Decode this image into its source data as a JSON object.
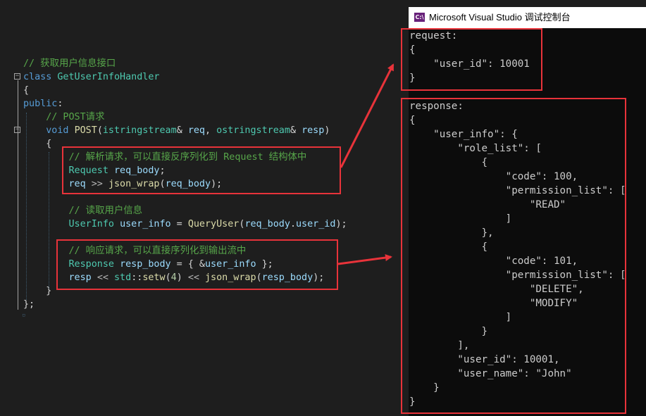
{
  "editor": {
    "lines": [
      {
        "tokens": [
          [
            "cm",
            "// 获取用户信息接口"
          ]
        ]
      },
      {
        "tokens": [
          [
            "kw",
            "class"
          ],
          [
            "pl",
            " "
          ],
          [
            "ty",
            "GetUserInfoHandler"
          ]
        ]
      },
      {
        "tokens": [
          [
            "pl",
            "{"
          ]
        ]
      },
      {
        "tokens": [
          [
            "kw",
            "public"
          ],
          [
            "pl",
            ":"
          ]
        ]
      },
      {
        "tokens": [
          [
            "pl",
            "    "
          ],
          [
            "cm",
            "// POST请求"
          ]
        ]
      },
      {
        "tokens": [
          [
            "pl",
            "    "
          ],
          [
            "kw",
            "void"
          ],
          [
            "pl",
            " "
          ],
          [
            "fn",
            "POST"
          ],
          [
            "pl",
            "("
          ],
          [
            "ty",
            "istringstream"
          ],
          [
            "pl",
            "& "
          ],
          [
            "vr",
            "req"
          ],
          [
            "pl",
            ", "
          ],
          [
            "ty",
            "ostringstream"
          ],
          [
            "pl",
            "& "
          ],
          [
            "vr",
            "resp"
          ],
          [
            "pl",
            ")"
          ]
        ]
      },
      {
        "tokens": [
          [
            "pl",
            "    {"
          ]
        ]
      },
      {
        "tokens": [
          [
            "pl",
            "        "
          ],
          [
            "cm",
            "// 解析请求，可以直接反序列化到 Request 结构体中"
          ]
        ]
      },
      {
        "tokens": [
          [
            "pl",
            "        "
          ],
          [
            "ty",
            "Request"
          ],
          [
            "pl",
            " "
          ],
          [
            "vr",
            "req_body"
          ],
          [
            "pl",
            ";"
          ]
        ]
      },
      {
        "tokens": [
          [
            "pl",
            "        "
          ],
          [
            "vr",
            "req"
          ],
          [
            "pl",
            " "
          ],
          [
            "op",
            ">>"
          ],
          [
            "pl",
            " "
          ],
          [
            "fn",
            "json_wrap"
          ],
          [
            "pl",
            "("
          ],
          [
            "vr",
            "req_body"
          ],
          [
            "pl",
            ");"
          ]
        ]
      },
      {
        "tokens": [
          [
            "pl",
            ""
          ]
        ]
      },
      {
        "tokens": [
          [
            "pl",
            "        "
          ],
          [
            "cm",
            "// 读取用户信息"
          ]
        ]
      },
      {
        "tokens": [
          [
            "pl",
            "        "
          ],
          [
            "ty",
            "UserInfo"
          ],
          [
            "pl",
            " "
          ],
          [
            "vr",
            "user_info"
          ],
          [
            "pl",
            " = "
          ],
          [
            "fn",
            "QueryUser"
          ],
          [
            "pl",
            "("
          ],
          [
            "vr",
            "req_body"
          ],
          [
            "pl",
            "."
          ],
          [
            "vr",
            "user_id"
          ],
          [
            "pl",
            ");"
          ]
        ]
      },
      {
        "tokens": [
          [
            "pl",
            ""
          ]
        ]
      },
      {
        "tokens": [
          [
            "pl",
            "        "
          ],
          [
            "cm",
            "// 响应请求，可以直接序列化到输出流中"
          ]
        ]
      },
      {
        "tokens": [
          [
            "pl",
            "        "
          ],
          [
            "ty",
            "Response"
          ],
          [
            "pl",
            " "
          ],
          [
            "vr",
            "resp_body"
          ],
          [
            "pl",
            " = { &"
          ],
          [
            "vr",
            "user_info"
          ],
          [
            "pl",
            " };"
          ]
        ]
      },
      {
        "tokens": [
          [
            "pl",
            "        "
          ],
          [
            "vr",
            "resp"
          ],
          [
            "pl",
            " "
          ],
          [
            "op",
            "<<"
          ],
          [
            "pl",
            " "
          ],
          [
            "ty",
            "std"
          ],
          [
            "pl",
            "::"
          ],
          [
            "fn",
            "setw"
          ],
          [
            "pl",
            "("
          ],
          [
            "num",
            "4"
          ],
          [
            "pl",
            ") "
          ],
          [
            "op",
            "<<"
          ],
          [
            "pl",
            " "
          ],
          [
            "fn",
            "json_wrap"
          ],
          [
            "pl",
            "("
          ],
          [
            "vr",
            "resp_body"
          ],
          [
            "pl",
            ");"
          ]
        ]
      },
      {
        "tokens": [
          [
            "pl",
            "    }"
          ]
        ]
      },
      {
        "tokens": [
          [
            "pl",
            "};"
          ]
        ]
      }
    ]
  },
  "console": {
    "title": "Microsoft Visual Studio 调试控制台",
    "logo_text": "C:\\",
    "lines": [
      "request:",
      "{",
      "    \"user_id\": 10001",
      "}",
      "",
      "response:",
      "{",
      "    \"user_info\": {",
      "        \"role_list\": [",
      "            {",
      "                \"code\": 100,",
      "                \"permission_list\": [",
      "                    \"READ\"",
      "                ]",
      "            },",
      "            {",
      "                \"code\": 101,",
      "                \"permission_list\": [",
      "                    \"DELETE\",",
      "                    \"MODIFY\"",
      "                ]",
      "            }",
      "        ],",
      "        \"user_id\": 10001,",
      "        \"user_name\": \"John\"",
      "    }",
      "}"
    ]
  },
  "colors": {
    "highlight": "#e8333a",
    "comment": "#57a64a",
    "keyword": "#569cd6",
    "type": "#4ec9b0",
    "function": "#dcdcaa",
    "variable": "#9cdcfe"
  }
}
